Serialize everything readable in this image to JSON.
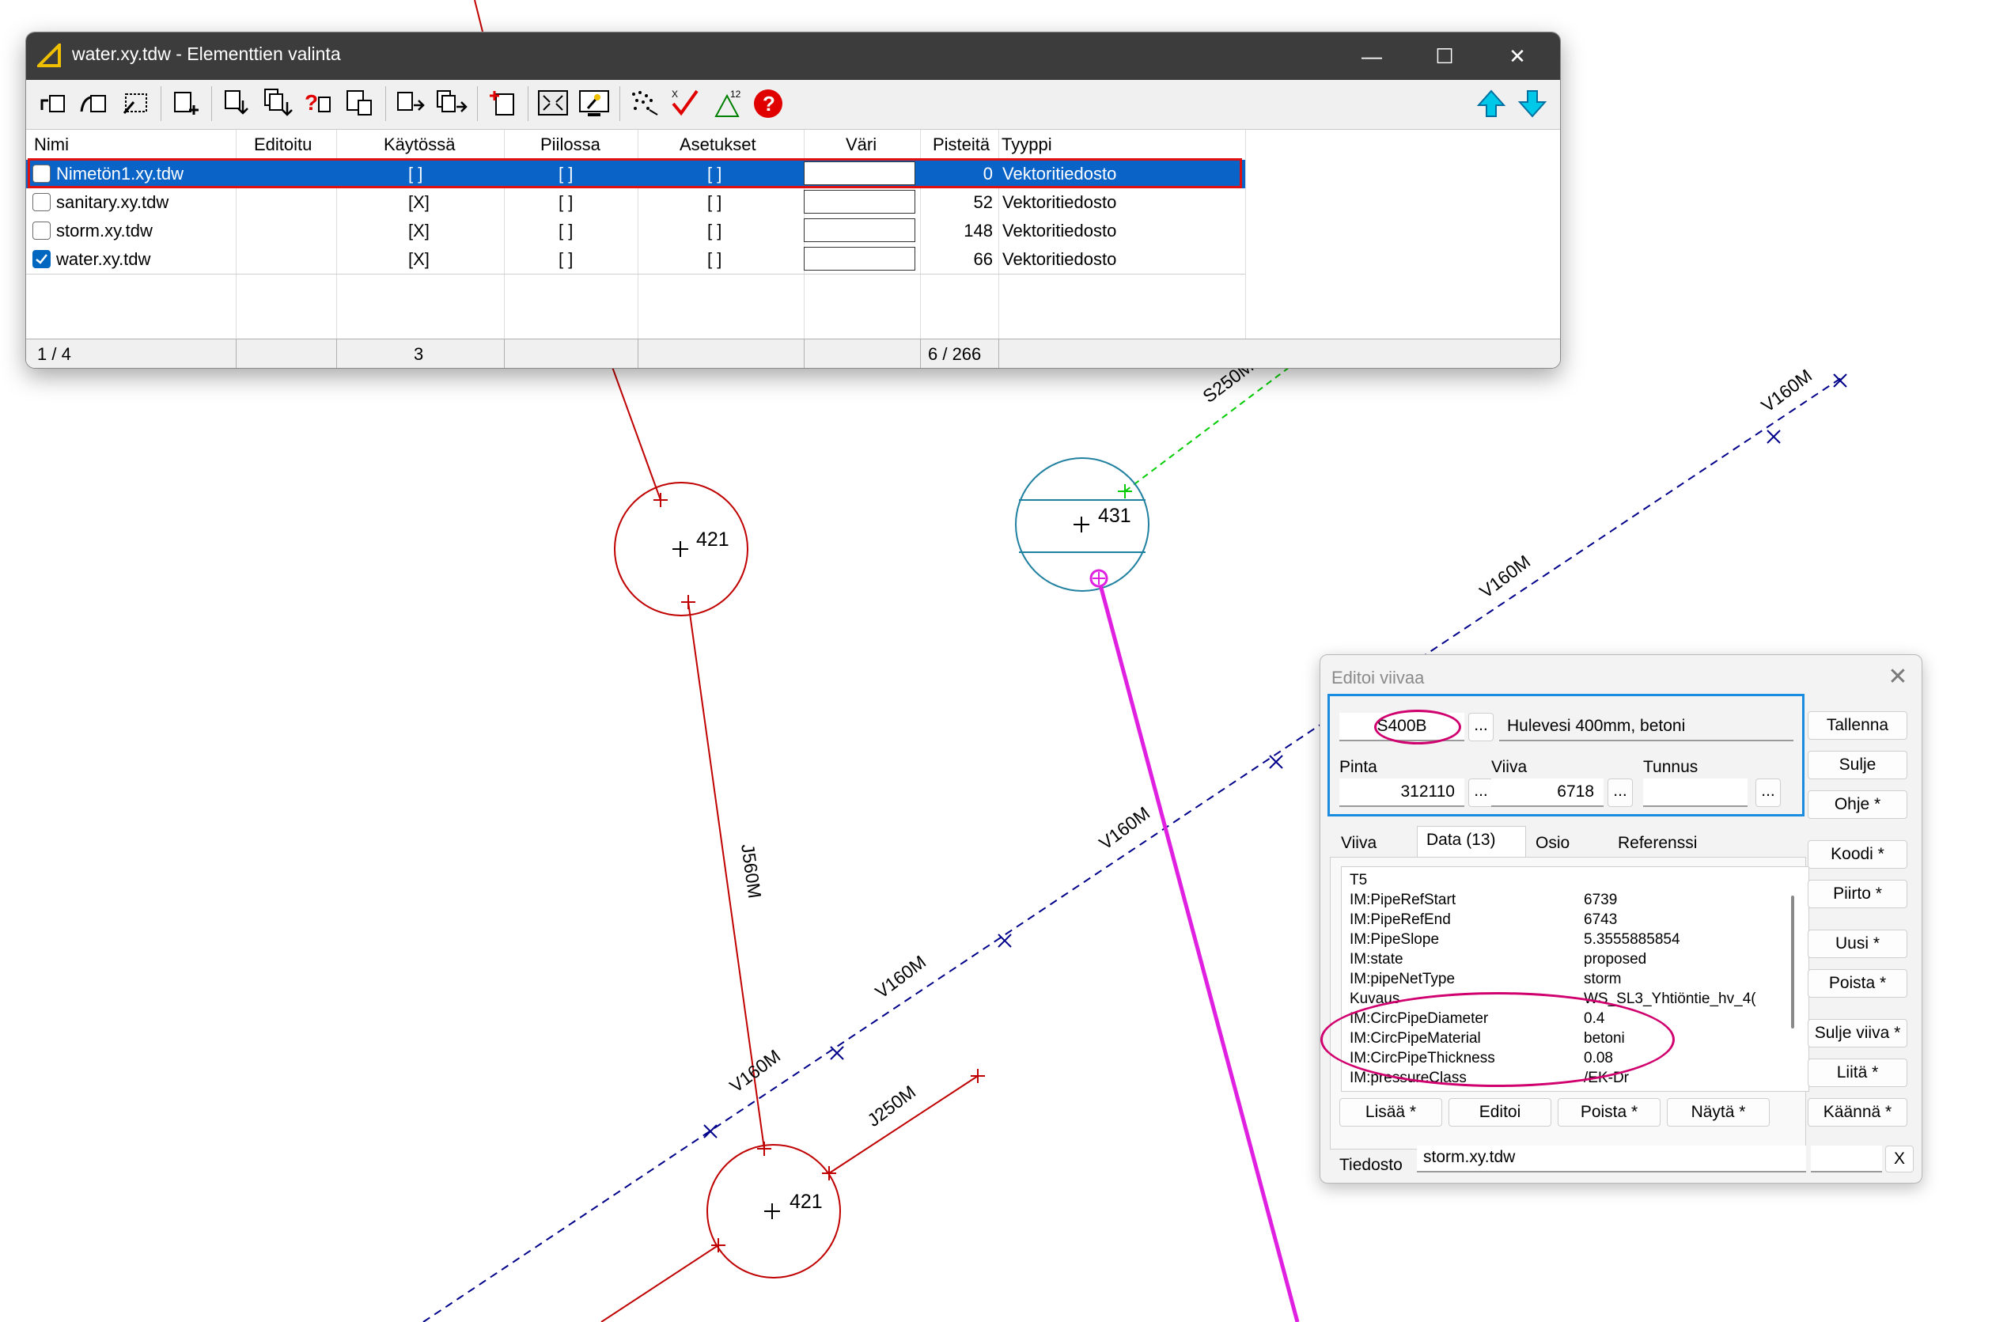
{
  "map": {
    "labels": {
      "node_421_top": "421",
      "node_431": "431",
      "node_421_bottom": "421",
      "s250m": "S250M",
      "v160m_1": "V160M",
      "v160m_2": "V160M",
      "v160m_3": "V160M",
      "v160m_4": "V160M",
      "v160m_5": "V160M",
      "j560m": "J560M",
      "j250m": "J250M"
    },
    "colors": {
      "sanitary": "#c00000",
      "water": "#00008b",
      "storm": "#e020e0",
      "green": "#00cc00",
      "node431": "#2080a0",
      "arrow": "#e01010"
    }
  },
  "main_window": {
    "title": "water.xy.tdw - Elementtien valinta",
    "controls": {
      "minimize": "—",
      "maximize": "☐",
      "close": "✕"
    },
    "toolbar_icons": [
      "rotate-left-icon",
      "rotate-right-icon",
      "select-pattern-icon",
      "add-layer-icon",
      "move-down-icon",
      "move-down-all-icon",
      "help-layer-icon",
      "export-layer-icon",
      "insert-icon",
      "insert-all-icon",
      "new-file-icon",
      "zoom-extents-icon",
      "display-icon",
      "scatter-icon",
      "check-icon",
      "triangle-icon",
      "help-icon",
      "arrow-up-icon",
      "arrow-down-icon"
    ],
    "table": {
      "headers": {
        "nimi": "Nimi",
        "editoitu": "Editoitu",
        "kaytossa": "Käytössä",
        "piilossa": "Piilossa",
        "asetukset": "Asetukset",
        "vari": "Väri",
        "pisteita": "Pisteitä",
        "tyyppi": "Tyyppi"
      },
      "rows": [
        {
          "name": "Nimetön1.xy.tdw",
          "checked": false,
          "selected": true,
          "kaytossa": "[ ]",
          "piilossa": "[ ]",
          "asetukset": "[ ]",
          "pisteita": "0",
          "tyyppi": "Vektoritiedosto"
        },
        {
          "name": "sanitary.xy.tdw",
          "checked": false,
          "selected": false,
          "kaytossa": "[X]",
          "piilossa": "[ ]",
          "asetukset": "[ ]",
          "pisteita": "52",
          "tyyppi": "Vektoritiedosto"
        },
        {
          "name": "storm.xy.tdw",
          "checked": false,
          "selected": false,
          "kaytossa": "[X]",
          "piilossa": "[ ]",
          "asetukset": "[ ]",
          "pisteita": "148",
          "tyyppi": "Vektoritiedosto"
        },
        {
          "name": "water.xy.tdw",
          "checked": true,
          "selected": false,
          "kaytossa": "[X]",
          "piilossa": "[ ]",
          "asetukset": "[ ]",
          "pisteita": "66",
          "tyyppi": "Vektoritiedosto"
        }
      ],
      "status": {
        "count": "1 / 4",
        "active": "3",
        "points": "6 / 266"
      }
    }
  },
  "dialog": {
    "title": "Editoi viivaa",
    "close": "✕",
    "code_value": "S400B",
    "description": "Hulevesi 400mm, betoni",
    "ellipsis": "...",
    "labels": {
      "pinta": "Pinta",
      "viiva": "Viiva",
      "tunnus": "Tunnus",
      "tiedosto": "Tiedosto"
    },
    "pinta_value": "312110",
    "viiva_value": "6718",
    "tunnus_value": "",
    "tabs": [
      "Viiva",
      "Data (13)",
      "Osio",
      "Referenssi"
    ],
    "data_rows": [
      {
        "key": "T5",
        "value": ""
      },
      {
        "key": "IM:PipeRefStart",
        "value": "6739"
      },
      {
        "key": "IM:PipeRefEnd",
        "value": "6743"
      },
      {
        "key": "IM:PipeSlope",
        "value": "5.3555885854"
      },
      {
        "key": "IM:state",
        "value": "proposed"
      },
      {
        "key": "IM:pipeNetType",
        "value": "storm"
      },
      {
        "key": "Kuvaus",
        "value": "WS_SL3_Yhtiöntie_hv_4("
      },
      {
        "key": "IM:CircPipeDiameter",
        "value": "0.4"
      },
      {
        "key": "IM:CircPipeMaterial",
        "value": "betoni"
      },
      {
        "key": "IM:CircPipeThickness",
        "value": "0.08"
      },
      {
        "key": "IM:pressureClass",
        "value": "/EK-Dr"
      }
    ],
    "data_buttons": {
      "lisaa": "Lisää *",
      "editoi": "Editoi",
      "poista": "Poista *",
      "nayta": "Näytä *"
    },
    "side_buttons": {
      "tallenna": "Tallenna",
      "sulje": "Sulje",
      "ohje": "Ohje *",
      "koodi": "Koodi *",
      "piirto": "Piirto *",
      "uusi": "Uusi *",
      "poista": "Poista *",
      "sulje_viiva": "Sulje viiva *",
      "liita": "Liitä *",
      "kaanna": "Käännä *"
    },
    "tiedosto_value": "storm.xy.tdw",
    "x_button": "X"
  }
}
